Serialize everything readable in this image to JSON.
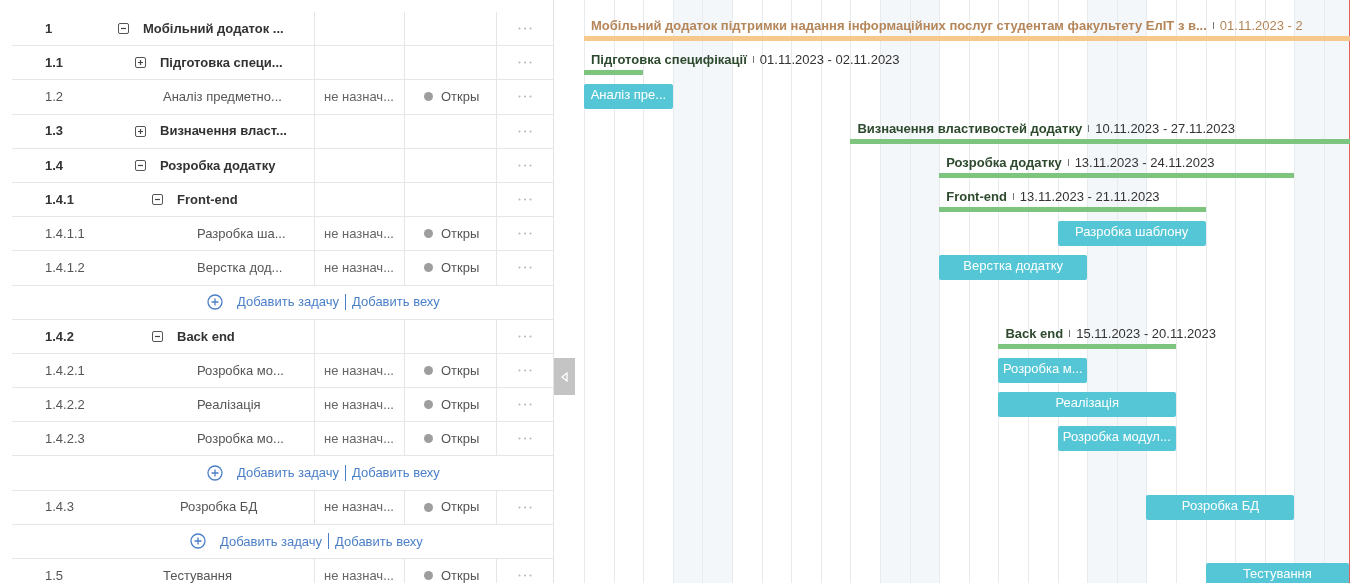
{
  "table": {
    "rows": [
      {
        "kind": "group",
        "number": "1",
        "name": "Мобільний додаток ...",
        "expanded": true,
        "children": [
          {
            "kind": "group",
            "number": "1.1",
            "name": "Підготовка специ...",
            "expanded": false
          },
          {
            "kind": "task",
            "number": "1.2",
            "name": "Аналіз предметно...",
            "assignee": "не назнач...",
            "status": "Откры"
          },
          {
            "kind": "group",
            "number": "1.3",
            "name": "Визначення власт...",
            "expanded": false
          },
          {
            "kind": "group",
            "number": "1.4",
            "name": "Розробка додатку",
            "expanded": true,
            "children": [
              {
                "kind": "group",
                "number": "1.4.1",
                "name": "Front-end",
                "expanded": true,
                "children": [
                  {
                    "kind": "task",
                    "number": "1.4.1.1",
                    "name": "Разробка ша...",
                    "assignee": "не назнач...",
                    "status": "Откры"
                  },
                  {
                    "kind": "task",
                    "number": "1.4.1.2",
                    "name": "Верстка дод...",
                    "assignee": "не назнач...",
                    "status": "Откры"
                  },
                  {
                    "kind": "add",
                    "add_task": "Добавить задачу",
                    "add_milestone": "Добавить веху"
                  }
                ]
              },
              {
                "kind": "group",
                "number": "1.4.2",
                "name": "Back end",
                "expanded": true,
                "children": [
                  {
                    "kind": "task",
                    "number": "1.4.2.1",
                    "name": "Розробка мо...",
                    "assignee": "не назнач...",
                    "status": "Откры"
                  },
                  {
                    "kind": "task",
                    "number": "1.4.2.2",
                    "name": "Реалізація",
                    "assignee": "не назнач...",
                    "status": "Откры"
                  },
                  {
                    "kind": "task",
                    "number": "1.4.2.3",
                    "name": "Розробка мо...",
                    "assignee": "не назнач...",
                    "status": "Откры"
                  },
                  {
                    "kind": "add",
                    "add_task": "Добавить задачу",
                    "add_milestone": "Добавить веху"
                  }
                ]
              },
              {
                "kind": "task",
                "number": "1.4.3",
                "name": "Розробка БД",
                "assignee": "не назнач...",
                "status": "Откры"
              },
              {
                "kind": "add",
                "add_task": "Добавить задачу",
                "add_milestone": "Добавить веху"
              }
            ]
          },
          {
            "kind": "task",
            "number": "1.5",
            "name": "Тестування",
            "assignee": "не назнач...",
            "status": "Откры"
          }
        ]
      }
    ]
  },
  "gantt": {
    "bars": [
      {
        "kind": "project",
        "label": "Мобільний додаток підтримки надання інформаційних послуг студентам факультету ЕлІТ з в...",
        "dates": "01.11.2023 - 2"
      },
      {
        "kind": "summary",
        "label": "Підготовка специфікації",
        "dates": "01.11.2023 - 02.11.2023"
      },
      {
        "kind": "task",
        "label": "Аналіз пре..."
      },
      {
        "kind": "summary",
        "label": "Визначення властивостей додатку",
        "dates": "10.11.2023 - 27.11.2023"
      },
      {
        "kind": "summary",
        "label": "Розробка додатку",
        "dates": "13.11.2023 - 24.11.2023"
      },
      {
        "kind": "summary",
        "label": "Front-end",
        "dates": "13.11.2023 - 21.11.2023"
      },
      {
        "kind": "task",
        "label": "Разробка шаблону"
      },
      {
        "kind": "task",
        "label": "Верстка додатку"
      },
      {
        "kind": "summary",
        "label": "Back end",
        "dates": "15.11.2023 - 20.11.2023"
      },
      {
        "kind": "task",
        "label": "Розробка м..."
      },
      {
        "kind": "task",
        "label": "Реалізація"
      },
      {
        "kind": "task",
        "label": "Розробка модул..."
      },
      {
        "kind": "task",
        "label": "Розробка БД"
      },
      {
        "kind": "task",
        "label": "Тестування"
      }
    ]
  }
}
